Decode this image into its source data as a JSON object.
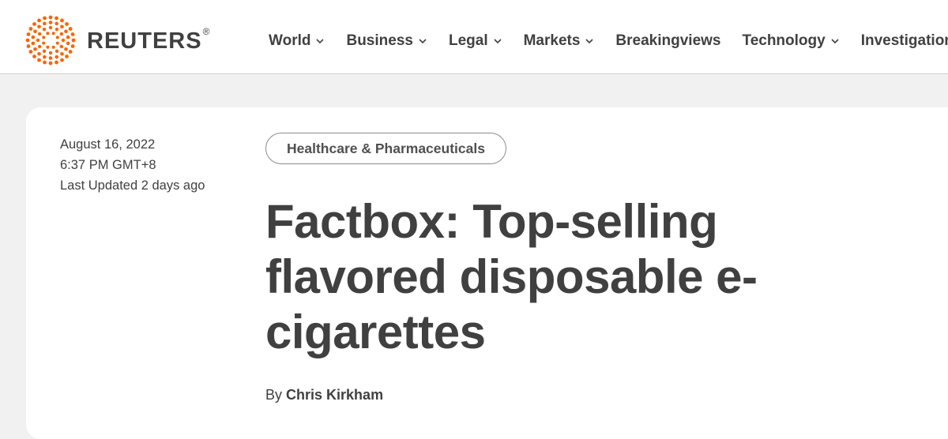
{
  "brand": {
    "name": "REUTERS",
    "registered_mark": "®",
    "accent_color": "#fa6400"
  },
  "nav": {
    "items": [
      {
        "label": "World",
        "has_dropdown": true
      },
      {
        "label": "Business",
        "has_dropdown": true
      },
      {
        "label": "Legal",
        "has_dropdown": true
      },
      {
        "label": "Markets",
        "has_dropdown": true
      },
      {
        "label": "Breakingviews",
        "has_dropdown": false
      },
      {
        "label": "Technology",
        "has_dropdown": true
      },
      {
        "label": "Investigations",
        "has_dropdown": false
      }
    ]
  },
  "article": {
    "date": "August 16, 2022",
    "time": "6:37 PM GMT+8",
    "last_updated": "Last Updated 2 days ago",
    "category_tag": "Healthcare & Pharmaceuticals",
    "headline": "Factbox: Top-selling flavored disposable e-cigarettes",
    "byline_prefix": "By",
    "author": "Chris Kirkham"
  }
}
